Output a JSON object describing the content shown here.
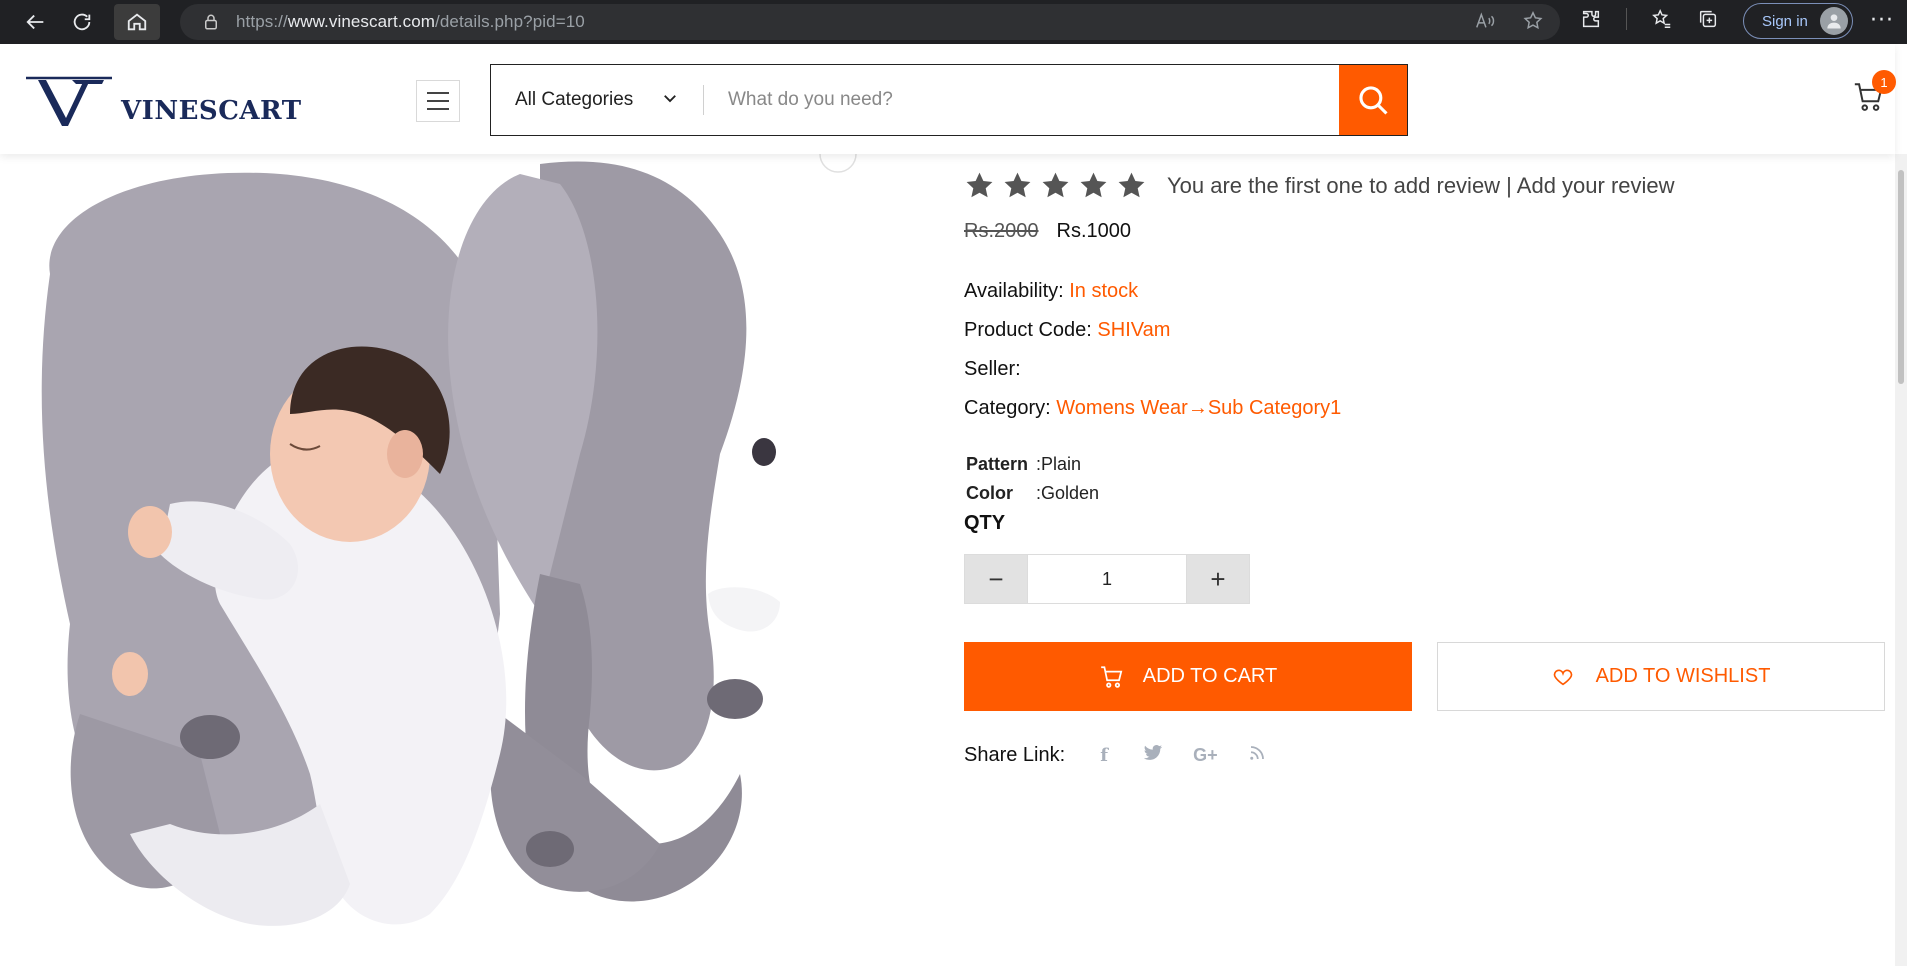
{
  "browser": {
    "url_prefix": "https://",
    "url_domain": "www.vinescart.com",
    "url_path": "/details.php?pid=10",
    "signin_label": "Sign in"
  },
  "site": {
    "logo_text": "VINESCART",
    "search": {
      "category": "All Categories",
      "placeholder": "What do you need?"
    },
    "cart_count": "1"
  },
  "product": {
    "rating_stars": 5,
    "review_text": "You are the first one to add review | Add your review",
    "price_old": "Rs.2000",
    "price_new": "Rs.1000",
    "availability_label": "Availability:",
    "availability_value": "In stock",
    "code_label": "Product Code:",
    "code_value": "SHIVam",
    "seller_label": "Seller:",
    "category_label": "Category:",
    "category_value": "Womens Wear",
    "subcategory_value": "Sub Category1",
    "attributes": [
      {
        "key": "Pattern",
        "value": ":Plain"
      },
      {
        "key": "Color",
        "value": ":Golden"
      }
    ],
    "qty_label": "QTY",
    "qty_value": "1",
    "add_to_cart_label": "ADD TO CART",
    "add_to_wishlist_label": "ADD TO WISHLIST",
    "share_label": "Share Link:"
  },
  "colors": {
    "accent": "#ff5a00",
    "chrome_bg": "#202124",
    "logo_navy": "#1a2a5a"
  }
}
